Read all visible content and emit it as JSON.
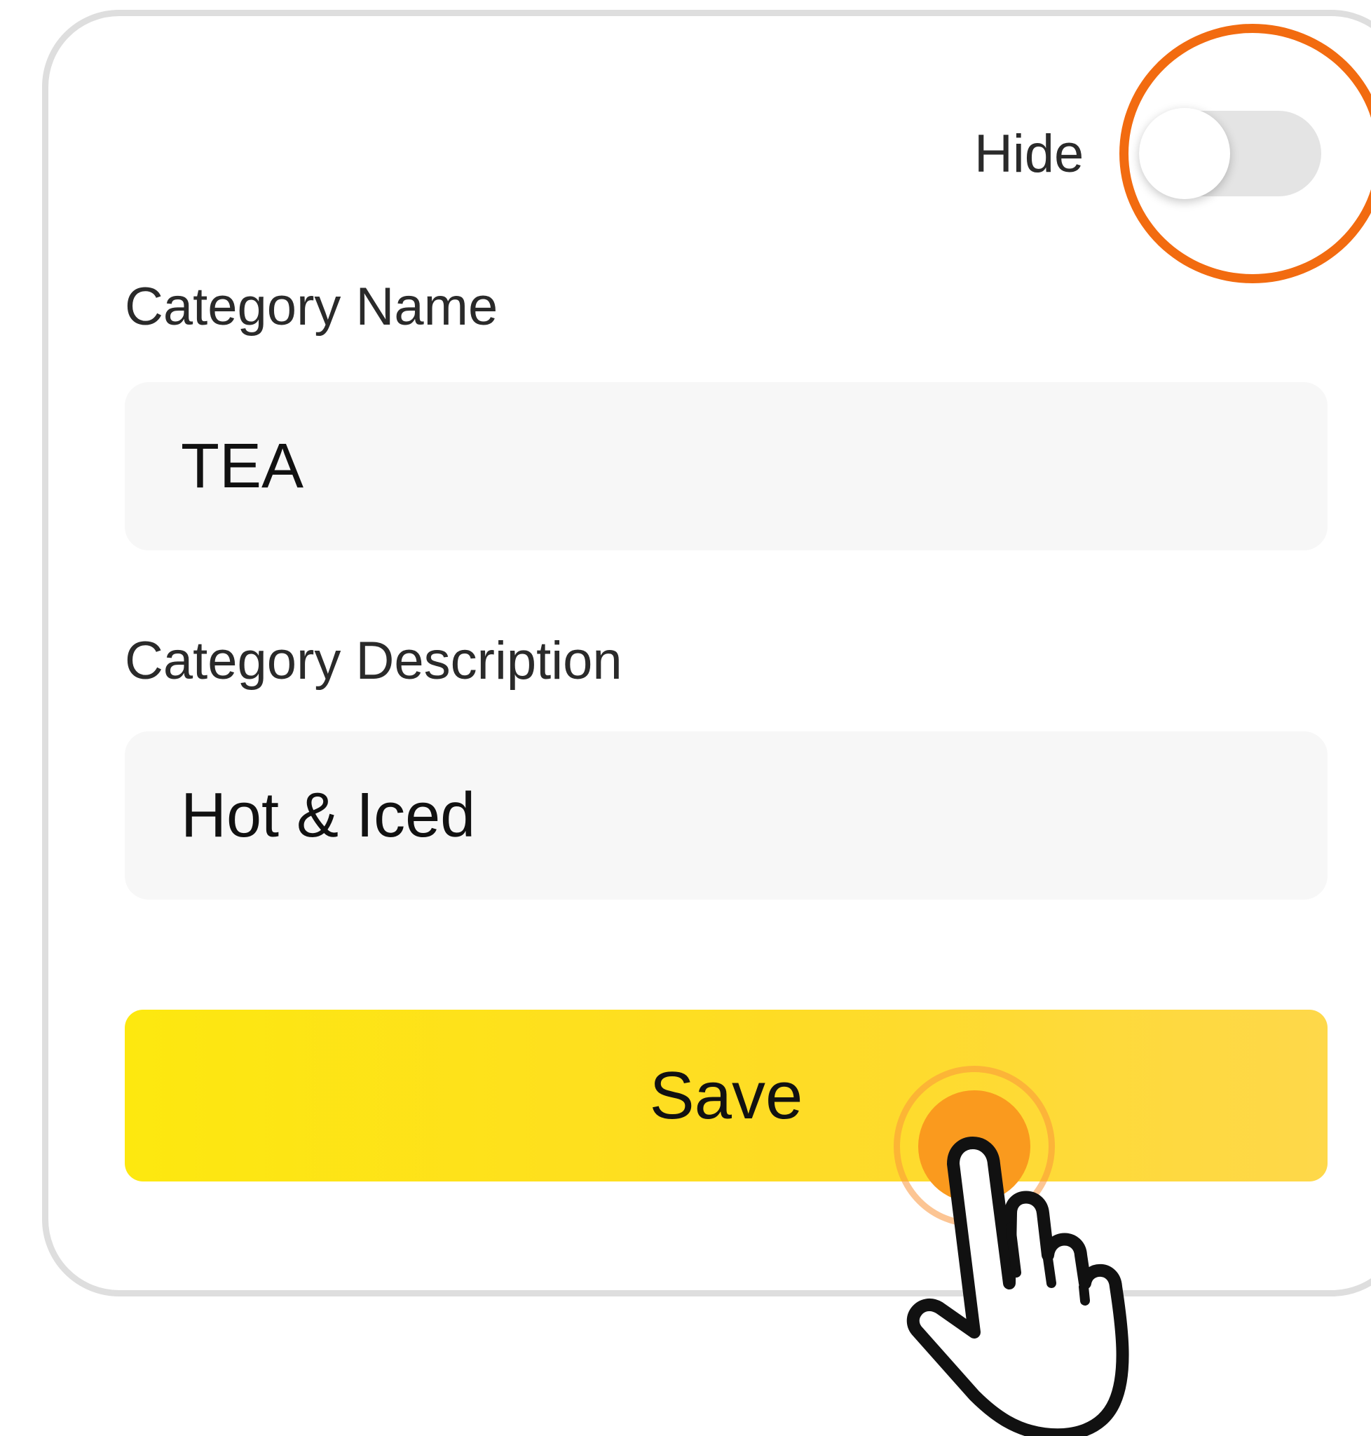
{
  "form": {
    "hide_label": "Hide",
    "hide_toggle_on": false,
    "category_name_label": "Category Name",
    "category_name_value": "TEA",
    "category_description_label": "Category Description",
    "category_description_value": "Hot & Iced",
    "save_label": "Save"
  },
  "colors": {
    "accent": "#fde80f",
    "highlight": "#f26b10",
    "tap": "#fa9a1e"
  },
  "icons": {
    "cursor": "hand-pointer-icon"
  }
}
